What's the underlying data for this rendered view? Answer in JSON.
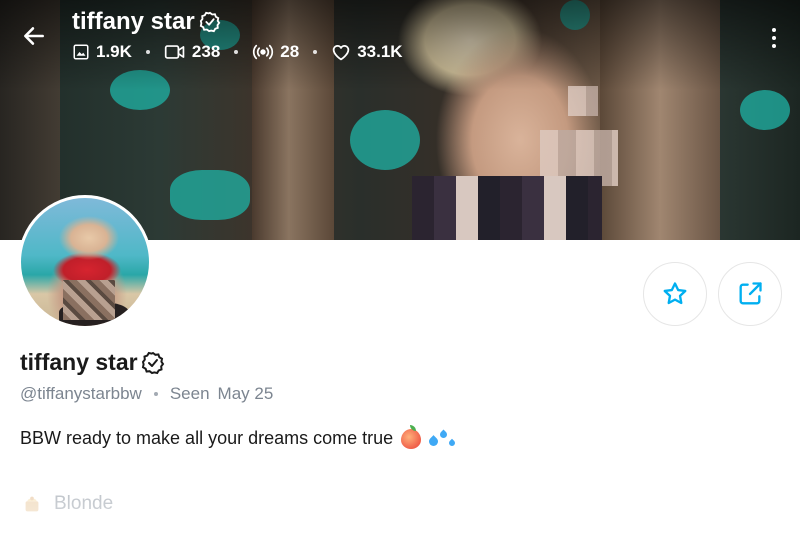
{
  "header": {
    "title": "tiffany star",
    "stats": [
      {
        "icon": "image-icon",
        "value": "1.9K"
      },
      {
        "icon": "video-icon",
        "value": "238"
      },
      {
        "icon": "live-stream-icon",
        "value": "28"
      },
      {
        "icon": "heart-icon",
        "value": "33.1K"
      }
    ]
  },
  "profile": {
    "name": "tiffany star",
    "handle": "@tiffanystarbbw",
    "seen_label": "Seen",
    "seen_date": "May 25",
    "bio": "BBW ready to make all your dreams come true",
    "attribute": {
      "icon": "hair-icon",
      "label": "Blonde"
    }
  },
  "colors": {
    "accent": "#00aff0",
    "text": "#1a1a1a",
    "muted": "#7c8590"
  }
}
